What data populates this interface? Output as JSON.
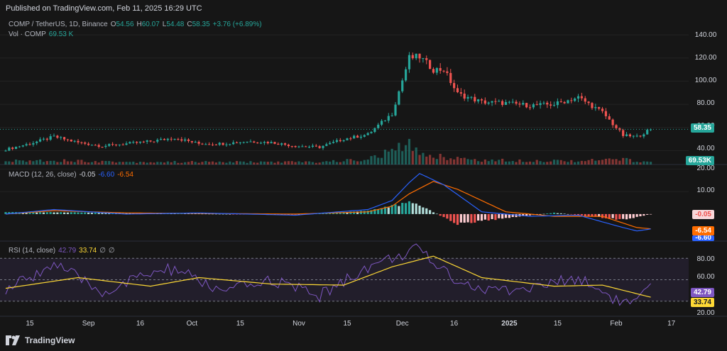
{
  "header": {
    "published": "Published on TradingView.com, Feb 11, 2025 16:29 UTC"
  },
  "legend": {
    "symbol": "COMP / TetherUS, 1D, Binance",
    "o_label": "O",
    "o_val": "54.56",
    "h_label": "H",
    "h_val": "60.07",
    "l_label": "L",
    "l_val": "54.48",
    "c_label": "C",
    "c_val": "58.35",
    "change": "+3.76 (+6.89%)",
    "vol_label": "Vol · COMP",
    "vol_val": "69.53 K"
  },
  "macd_legend": {
    "label": "MACD (12, 26, close)",
    "hist": "-0.05",
    "macd": "-6.60",
    "signal": "-6.54"
  },
  "rsi_legend": {
    "label": "RSI (14, close)",
    "rsi": "42.79",
    "ma": "33.74",
    "n1": "∅",
    "n2": "∅"
  },
  "badges": {
    "price": "58.35",
    "volume": "69.53K",
    "macd_hist": "-0.05",
    "macd_signal": "-6.54",
    "macd_line": "-6.60",
    "rsi": "42.79",
    "rsi_ma": "33.74"
  },
  "price_axis": [
    "140.00",
    "120.00",
    "100.00",
    "80.00",
    "60.00",
    "40.00"
  ],
  "macd_axis": [
    "20.00",
    "10.00"
  ],
  "rsi_axis": [
    "80.00",
    "60.00",
    "40.00",
    "20.00"
  ],
  "x_labels": [
    {
      "text": "15",
      "bold": false
    },
    {
      "text": "Sep",
      "bold": false
    },
    {
      "text": "16",
      "bold": false
    },
    {
      "text": "Oct",
      "bold": false
    },
    {
      "text": "15",
      "bold": false
    },
    {
      "text": "Nov",
      "bold": false
    },
    {
      "text": "15",
      "bold": false
    },
    {
      "text": "Dec",
      "bold": false
    },
    {
      "text": "16",
      "bold": false
    },
    {
      "text": "2025",
      "bold": true
    },
    {
      "text": "15",
      "bold": false
    },
    {
      "text": "Feb",
      "bold": false
    },
    {
      "text": "17",
      "bold": false
    }
  ],
  "footer": {
    "brand": "TradingView"
  },
  "colors": {
    "up": "#26a69a",
    "down": "#ef5350",
    "macd": "#2962ff",
    "signal": "#ff6d00",
    "rsi": "#7e57c2",
    "rsi_ma": "#fdd835",
    "bg": "#161616"
  },
  "chart_data": [
    {
      "type": "candlestick",
      "title": "COMP / TetherUS, 1D, Binance",
      "ylim": [
        28,
        148
      ],
      "x_start": "2024-08-08",
      "x_end": "2025-02-11",
      "close_series": [
        {
          "x": "2024-08-08",
          "y": 41
        },
        {
          "x": "2024-08-15",
          "y": 46
        },
        {
          "x": "2024-08-22",
          "y": 52
        },
        {
          "x": "2024-08-29",
          "y": 47
        },
        {
          "x": "2024-09-05",
          "y": 44
        },
        {
          "x": "2024-09-12",
          "y": 46
        },
        {
          "x": "2024-09-19",
          "y": 48
        },
        {
          "x": "2024-09-26",
          "y": 51
        },
        {
          "x": "2024-10-03",
          "y": 46
        },
        {
          "x": "2024-10-10",
          "y": 46
        },
        {
          "x": "2024-10-17",
          "y": 48
        },
        {
          "x": "2024-10-24",
          "y": 47
        },
        {
          "x": "2024-10-31",
          "y": 44
        },
        {
          "x": "2024-11-07",
          "y": 43
        },
        {
          "x": "2024-11-14",
          "y": 50
        },
        {
          "x": "2024-11-21",
          "y": 54
        },
        {
          "x": "2024-11-28",
          "y": 72
        },
        {
          "x": "2024-12-03",
          "y": 120
        },
        {
          "x": "2024-12-06",
          "y": 121
        },
        {
          "x": "2024-12-10",
          "y": 110
        },
        {
          "x": "2024-12-13",
          "y": 110
        },
        {
          "x": "2024-12-17",
          "y": 89
        },
        {
          "x": "2024-12-24",
          "y": 82
        },
        {
          "x": "2024-12-31",
          "y": 81
        },
        {
          "x": "2025-01-07",
          "y": 79
        },
        {
          "x": "2025-01-14",
          "y": 80
        },
        {
          "x": "2025-01-21",
          "y": 86
        },
        {
          "x": "2025-01-28",
          "y": 73
        },
        {
          "x": "2025-02-03",
          "y": 53
        },
        {
          "x": "2025-02-07",
          "y": 52
        },
        {
          "x": "2025-02-11",
          "y": 58.35
        }
      ],
      "volume_series": [
        {
          "x": "2024-08-08",
          "y": 8
        },
        {
          "x": "2024-08-22",
          "y": 10
        },
        {
          "x": "2024-09-12",
          "y": 6
        },
        {
          "x": "2024-10-10",
          "y": 6
        },
        {
          "x": "2024-11-07",
          "y": 6
        },
        {
          "x": "2024-11-21",
          "y": 12
        },
        {
          "x": "2024-12-03",
          "y": 45
        },
        {
          "x": "2024-12-05",
          "y": 32
        },
        {
          "x": "2024-12-10",
          "y": 20
        },
        {
          "x": "2024-12-24",
          "y": 10
        },
        {
          "x": "2025-01-21",
          "y": 9
        },
        {
          "x": "2025-02-03",
          "y": 12
        },
        {
          "x": "2025-02-11",
          "y": 5
        }
      ]
    },
    {
      "type": "line",
      "title": "MACD (12, 26, close)",
      "ylim": [
        -12,
        22
      ],
      "series": [
        {
          "name": "MACD",
          "values": [
            {
              "x": "2024-08-08",
              "y": 0
            },
            {
              "x": "2024-08-22",
              "y": 2
            },
            {
              "x": "2024-09-12",
              "y": 0
            },
            {
              "x": "2024-10-03",
              "y": 0.5
            },
            {
              "x": "2024-10-31",
              "y": -0.5
            },
            {
              "x": "2024-11-21",
              "y": 2
            },
            {
              "x": "2024-11-28",
              "y": 6
            },
            {
              "x": "2024-12-03",
              "y": 14
            },
            {
              "x": "2024-12-06",
              "y": 18
            },
            {
              "x": "2024-12-13",
              "y": 13
            },
            {
              "x": "2024-12-24",
              "y": 1
            },
            {
              "x": "2025-01-07",
              "y": -1
            },
            {
              "x": "2025-01-21",
              "y": -0.5
            },
            {
              "x": "2025-02-03",
              "y": -6
            },
            {
              "x": "2025-02-07",
              "y": -7.5
            },
            {
              "x": "2025-02-11",
              "y": -6.6
            }
          ]
        },
        {
          "name": "Signal",
          "values": [
            {
              "x": "2024-08-08",
              "y": 0
            },
            {
              "x": "2024-08-22",
              "y": 1.5
            },
            {
              "x": "2024-09-12",
              "y": 0.5
            },
            {
              "x": "2024-10-31",
              "y": 0
            },
            {
              "x": "2024-11-21",
              "y": 1
            },
            {
              "x": "2024-11-28",
              "y": 3.5
            },
            {
              "x": "2024-12-03",
              "y": 9
            },
            {
              "x": "2024-12-10",
              "y": 14.5
            },
            {
              "x": "2024-12-17",
              "y": 11
            },
            {
              "x": "2024-12-31",
              "y": 1
            },
            {
              "x": "2025-01-14",
              "y": -1
            },
            {
              "x": "2025-01-28",
              "y": -1
            },
            {
              "x": "2025-02-07",
              "y": -6
            },
            {
              "x": "2025-02-11",
              "y": -6.54
            }
          ]
        },
        {
          "name": "Histogram",
          "values": [
            {
              "x": "2024-08-22",
              "y": 0.8
            },
            {
              "x": "2024-10-31",
              "y": -0.3
            },
            {
              "x": "2024-11-21",
              "y": 1.5
            },
            {
              "x": "2024-12-03",
              "y": 5
            },
            {
              "x": "2024-12-06",
              "y": 4
            },
            {
              "x": "2024-12-17",
              "y": -4.5
            },
            {
              "x": "2024-12-24",
              "y": -3
            },
            {
              "x": "2025-01-14",
              "y": 0.6
            },
            {
              "x": "2025-02-03",
              "y": -2.5
            },
            {
              "x": "2025-02-11",
              "y": -0.05
            }
          ]
        }
      ]
    },
    {
      "type": "line",
      "title": "RSI (14, close)",
      "ylim": [
        16,
        86
      ],
      "bands": {
        "upper": 70,
        "middle": 50,
        "lower": 30
      },
      "series": [
        {
          "name": "RSI",
          "values": [
            {
              "x": "2024-08-08",
              "y": 40
            },
            {
              "x": "2024-08-22",
              "y": 65
            },
            {
              "x": "2024-09-05",
              "y": 38
            },
            {
              "x": "2024-09-19",
              "y": 56
            },
            {
              "x": "2024-09-26",
              "y": 60
            },
            {
              "x": "2024-10-10",
              "y": 38
            },
            {
              "x": "2024-10-24",
              "y": 50
            },
            {
              "x": "2024-11-07",
              "y": 35
            },
            {
              "x": "2024-11-21",
              "y": 62
            },
            {
              "x": "2024-12-03",
              "y": 76
            },
            {
              "x": "2024-12-05",
              "y": 78
            },
            {
              "x": "2024-12-17",
              "y": 50
            },
            {
              "x": "2024-12-24",
              "y": 40
            },
            {
              "x": "2025-01-07",
              "y": 42
            },
            {
              "x": "2025-01-21",
              "y": 52
            },
            {
              "x": "2025-02-03",
              "y": 28
            },
            {
              "x": "2025-02-07",
              "y": 30
            },
            {
              "x": "2025-02-11",
              "y": 42.79
            }
          ]
        },
        {
          "name": "RSI MA",
          "values": [
            {
              "x": "2024-08-08",
              "y": 42
            },
            {
              "x": "2024-08-29",
              "y": 52
            },
            {
              "x": "2024-09-19",
              "y": 44
            },
            {
              "x": "2024-10-03",
              "y": 52
            },
            {
              "x": "2024-10-24",
              "y": 46
            },
            {
              "x": "2024-11-14",
              "y": 45
            },
            {
              "x": "2024-11-28",
              "y": 62
            },
            {
              "x": "2024-12-10",
              "y": 72
            },
            {
              "x": "2024-12-24",
              "y": 52
            },
            {
              "x": "2025-01-14",
              "y": 44
            },
            {
              "x": "2025-01-28",
              "y": 45
            },
            {
              "x": "2025-02-11",
              "y": 33.74
            }
          ]
        }
      ]
    }
  ]
}
